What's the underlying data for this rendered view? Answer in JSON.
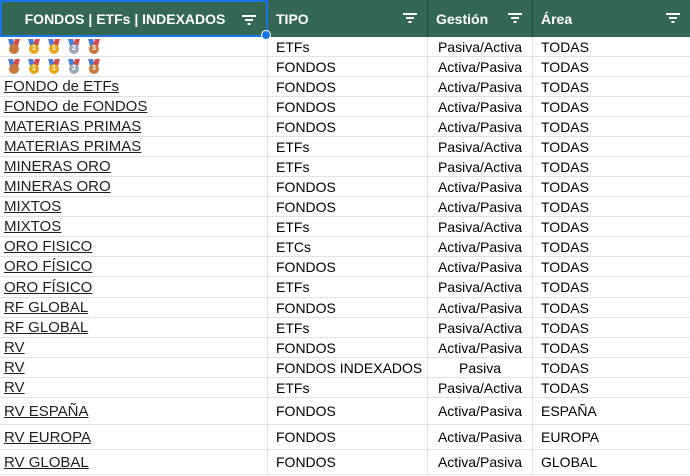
{
  "header": {
    "columns": [
      "FONDOS | ETFs | INDEXADOS",
      "TIPO",
      "Gestión",
      "Área"
    ]
  },
  "medal_row_icons": [
    {
      "name": "bronze-medal-icon",
      "color": "#c87a3e",
      "label": " "
    },
    {
      "name": "gold-medal-icon",
      "color": "#e6a817",
      "label": "1"
    },
    {
      "name": "gold-medal-icon",
      "color": "#e6a817",
      "label": "1"
    },
    {
      "name": "silver-medal-icon",
      "color": "#9aa7b8",
      "label": "2"
    },
    {
      "name": "bronze-medal-icon",
      "color": "#c87a3e",
      "label": "3"
    }
  ],
  "rows": [
    {
      "name": "",
      "medals": true,
      "tipo": "ETFs",
      "gestion": "Pasiva/Activa",
      "area": "TODAS"
    },
    {
      "name": "",
      "medals": true,
      "tipo": "FONDOS",
      "gestion": "Activa/Pasiva",
      "area": "TODAS"
    },
    {
      "name": "FONDO de ETFs",
      "tipo": "FONDOS",
      "gestion": "Activa/Pasiva",
      "area": "TODAS"
    },
    {
      "name": "FONDO de FONDOS",
      "tipo": "FONDOS",
      "gestion": "Activa/Pasiva",
      "area": "TODAS"
    },
    {
      "name": "MATERIAS PRIMAS",
      "tipo": "FONDOS",
      "gestion": "Activa/Pasiva",
      "area": "TODAS"
    },
    {
      "name": "MATERIAS PRIMAS",
      "tipo": "ETFs",
      "gestion": "Pasiva/Activa",
      "area": "TODAS"
    },
    {
      "name": "MINERAS ORO",
      "tipo": "ETFs",
      "gestion": "Pasiva/Activa",
      "area": "TODAS"
    },
    {
      "name": "MINERAS ORO",
      "tipo": "FONDOS",
      "gestion": "Activa/Pasiva",
      "area": "TODAS"
    },
    {
      "name": "MIXTOS",
      "tipo": "FONDOS",
      "gestion": "Activa/Pasiva",
      "area": "TODAS"
    },
    {
      "name": "MIXTOS",
      "tipo": "ETFs",
      "gestion": "Pasiva/Activa",
      "area": "TODAS"
    },
    {
      "name": "ORO FISICO",
      "tipo": "ETCs",
      "gestion": "Activa/Pasiva",
      "area": "TODAS"
    },
    {
      "name": "ORO FÍSICO",
      "tipo": "FONDOS",
      "gestion": "Activa/Pasiva",
      "area": "TODAS"
    },
    {
      "name": "ORO FÍSICO",
      "tipo": "ETFs",
      "gestion": "Pasiva/Activa",
      "area": "TODAS"
    },
    {
      "name": "RF GLOBAL",
      "tipo": "FONDOS",
      "gestion": "Activa/Pasiva",
      "area": "TODAS"
    },
    {
      "name": "RF GLOBAL",
      "tipo": "ETFs",
      "gestion": "Pasiva/Activa",
      "area": "TODAS"
    },
    {
      "name": "RV",
      "tipo": "FONDOS",
      "gestion": "Activa/Pasiva",
      "area": "TODAS"
    },
    {
      "name": "RV",
      "tipo": "FONDOS INDEXADOS",
      "gestion": "Pasiva",
      "area": "TODAS"
    },
    {
      "name": "RV",
      "tipo": "ETFs",
      "gestion": "Pasiva/Activa",
      "area": "TODAS"
    },
    {
      "name": "RV ESPAÑA",
      "tipo": "FONDOS",
      "gestion": "Activa/Pasiva",
      "area": "ESPAÑA"
    },
    {
      "name": "RV EUROPA",
      "tipo": "FONDOS",
      "gestion": "Activa/Pasiva",
      "area": "EUROPA"
    },
    {
      "name": "RV GLOBAL",
      "tipo": "FONDOS",
      "gestion": "Activa/Pasiva",
      "area": "GLOBAL"
    }
  ]
}
